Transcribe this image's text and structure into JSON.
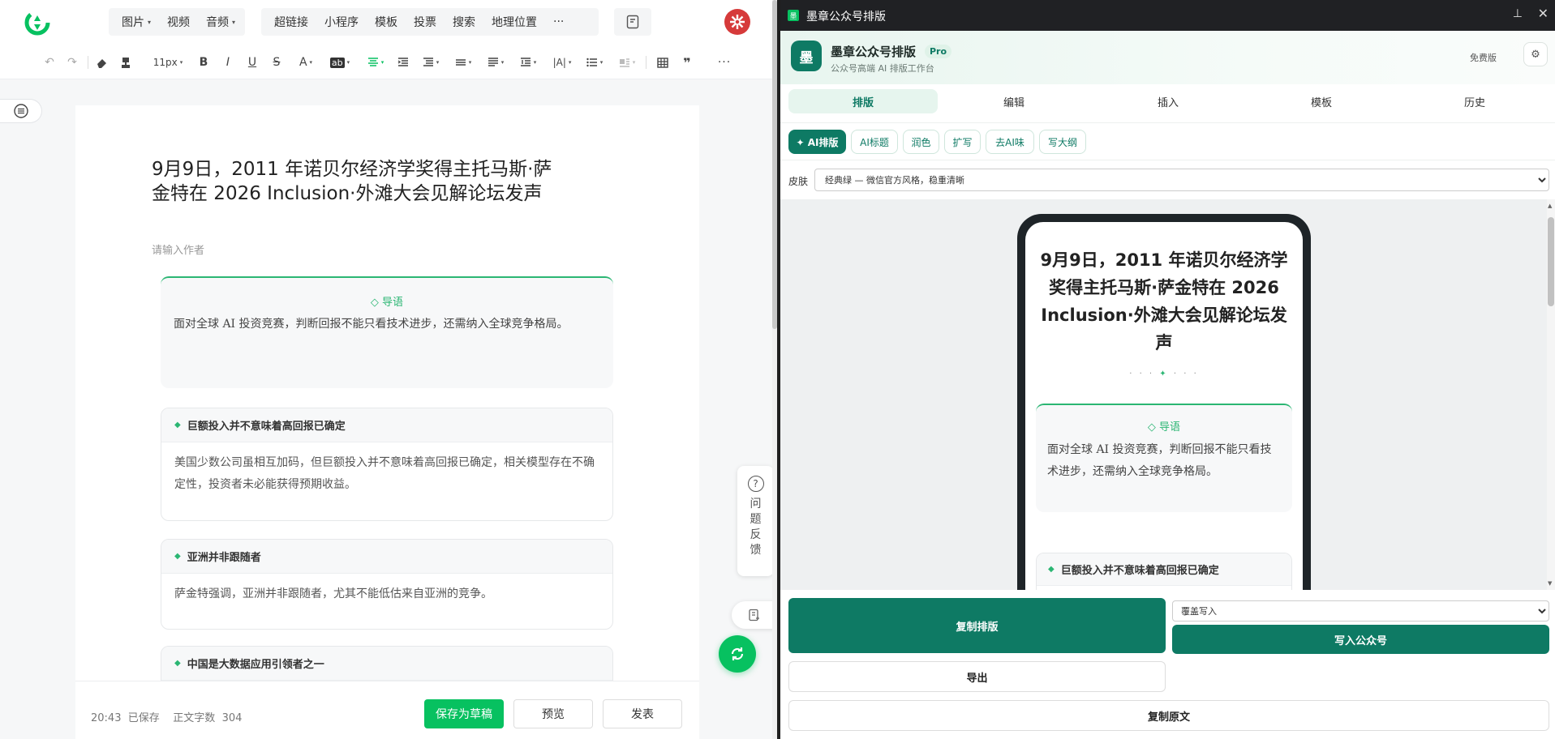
{
  "editor": {
    "nav_items": [
      {
        "label": "图片",
        "dropdown": true
      },
      {
        "label": "视频",
        "dropdown": false
      },
      {
        "label": "音频",
        "dropdown": true
      }
    ],
    "insert_items": [
      "超链接",
      "小程序",
      "模板",
      "投票",
      "搜索",
      "地理位置"
    ],
    "more_glyph": "···",
    "toolbar": {
      "font_size": "11px",
      "bold": "B",
      "italic": "I",
      "underline": "U",
      "strike": "S",
      "font_color": "A",
      "bg_color": "ab",
      "quote": "❞",
      "more": "···"
    },
    "article": {
      "title": "9月9日，2011 年诺贝尔经济学奖得主托马斯·萨金特在 2026 Inclusion·外滩大会见解论坛发声",
      "author_placeholder": "请输入作者",
      "lead_label": "◇ 导语",
      "lead_text": "面对全球 AI 投资竞赛，判断回报不能只看技术进步，还需纳入全球竞争格局。",
      "sections": [
        {
          "heading": "巨额投入并不意味着高回报已确定",
          "body": "美国少数公司虽相互加码，但巨额投入并不意味着高回报已确定，相关模型存在不确定性，投资者未必能获得预期收益。"
        },
        {
          "heading": "亚洲并非跟随者",
          "body": "萨金特强调，亚洲并非跟随者，尤其不能低估来自亚洲的竞争。"
        },
        {
          "heading": "中国是大数据应用引领者之一",
          "body": ""
        }
      ]
    },
    "footer": {
      "saved_time": "20:43",
      "saved_label": "已保存",
      "word_count_label": "正文字数",
      "word_count": "304",
      "save_draft": "保存为草稿",
      "preview": "预览",
      "publish": "发表"
    },
    "feedback": {
      "icon": "?",
      "label": "问题反馈"
    }
  },
  "panel": {
    "window_title": "墨章公众号排版",
    "app_icon_char": "墨",
    "name": "墨章公众号排版",
    "badge": "Pro",
    "subtitle": "公众号高端 AI 排版工作台",
    "plan": "免费版",
    "gear": "⚙",
    "tabs": [
      {
        "label": "排版",
        "active": true
      },
      {
        "label": "编辑",
        "active": false
      },
      {
        "label": "插入",
        "active": false
      },
      {
        "label": "模板",
        "active": false
      },
      {
        "label": "历史",
        "active": false
      }
    ],
    "actions": [
      "✦ AI排版",
      "AI标题",
      "润色",
      "扩写",
      "去AI味",
      "写大纲"
    ],
    "skin_label": "皮肤",
    "skin_value": "经典绿 — 微信官方风格，稳重清晰",
    "preview": {
      "title": "9月9日，2011 年诺贝尔经济学奖得主托马斯·萨金特在 2026 Inclusion·外滩大会见解论坛发声",
      "ornament_left": "· · · ",
      "ornament_mid": "✦",
      "ornament_right": " · · ·",
      "lead_label": "◇ 导语",
      "lead_text": "面对全球 AI 投资竞赛，判断回报不能只看技术进步，还需纳入全球竞争格局。",
      "section_heading": "巨额投入并不意味着高回报已确定"
    },
    "bottom": {
      "copy_layout": "复制排版",
      "write_mode": "覆盖写入",
      "write_to_mp": "写入公众号",
      "export": "导出",
      "copy_raw": "复制原文"
    }
  },
  "colors": {
    "wechat_green": "#07c160",
    "panel_teal": "#0e7a64",
    "accent_green": "#2bb673"
  }
}
